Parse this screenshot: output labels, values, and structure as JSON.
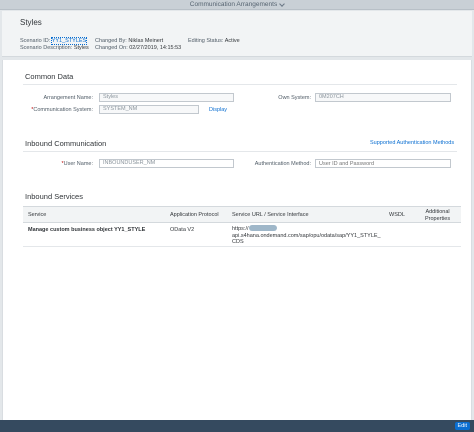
{
  "shell": {
    "title": "Communication Arrangements"
  },
  "header": {
    "title": "Styles",
    "scenario_id_label": "Scenario ID:",
    "scenario_id": "YY1_STYLES",
    "scenario_desc_label": "Scenario Description:",
    "scenario_desc": "Styles",
    "changed_by_label": "Changed By:",
    "changed_by": "Niklas Meinert",
    "changed_on_label": "Changed On:",
    "changed_on": "02/27/2019, 14:15:53",
    "editing_status_label": "Editing Status:",
    "editing_status": "Active"
  },
  "common_data": {
    "title": "Common Data",
    "arrangement_name_label": "Arrangement Name:",
    "arrangement_name": "Styles",
    "communication_system_label": "Communication System:",
    "communication_system": "SYSTEM_NM",
    "display_link": "Display",
    "own_system_label": "Own System:",
    "own_system": "0M207CH"
  },
  "inbound_communication": {
    "title": "Inbound Communication",
    "supported_auth_link": "Supported Authentication Methods",
    "user_name_label": "User Name:",
    "user_name": "INBOUNDUSER_NM",
    "auth_method_label": "Authentication Method:",
    "auth_method_placeholder": "User ID and Password"
  },
  "inbound_services": {
    "title": "Inbound Services",
    "columns": {
      "service": "Service",
      "protocol": "Application Protocol",
      "url": "Service URL / Service Interface",
      "wsdl": "WSDL",
      "additional_1": "Additional",
      "additional_2": "Properties"
    },
    "rows": [
      {
        "service": "Manage custom business object YY1_STYLE",
        "protocol": "OData V2",
        "url_line1": "https://",
        "url_line2": "api.s4hana.ondemand.com/sap/opu/odata/sap/YY1_STYLE_",
        "url_line3": "CDS"
      }
    ]
  },
  "footer": {
    "edit_label": "Edit"
  },
  "colors": {
    "accent": "#0a6ed1",
    "footer": "#354a5f",
    "required": "#bb0000"
  }
}
